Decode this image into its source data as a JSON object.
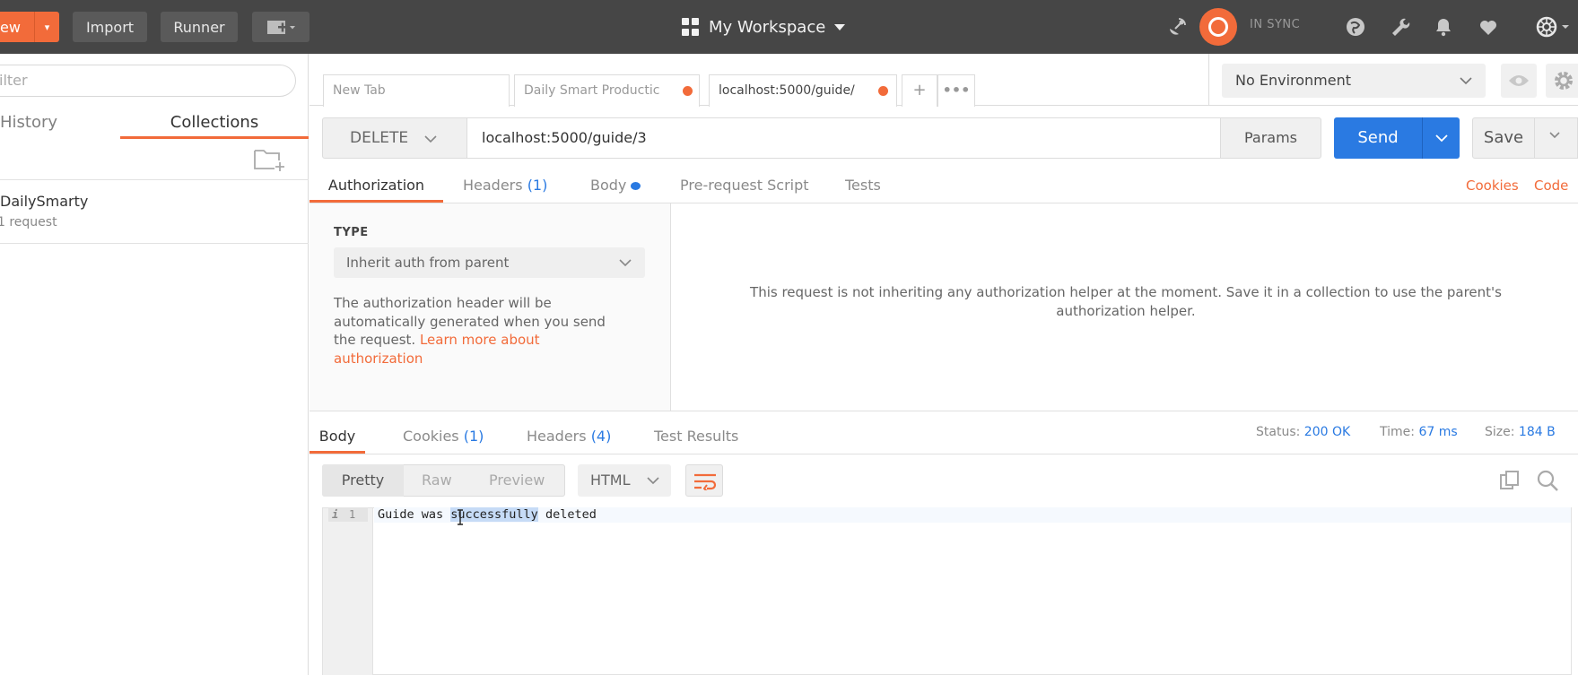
{
  "topbar": {
    "new_label": "ew",
    "import_label": "Import",
    "runner_label": "Runner",
    "workspace": "My Workspace",
    "sync_status": "IN SYNC",
    "accent": "#f26b3a"
  },
  "sidebar": {
    "filter_placeholder": "ilter",
    "tabs": {
      "history": "History",
      "collections": "Collections"
    },
    "collection": {
      "name": "DailySmarty",
      "count": "1 request"
    }
  },
  "request_tabs": [
    {
      "label": "New Tab"
    },
    {
      "label": "Daily Smart Productic"
    },
    {
      "label": "localhost:5000/guide/"
    }
  ],
  "environment": {
    "selected": "No Environment"
  },
  "request": {
    "method": "DELETE",
    "url": "localhost:5000/guide/3",
    "params_label": "Params",
    "send_label": "Send",
    "save_label": "Save",
    "tabs": {
      "authorization": "Authorization",
      "headers": "Headers",
      "headers_count": "(1)",
      "body": "Body",
      "prerequest": "Pre-request Script",
      "tests": "Tests"
    },
    "cookies_link": "Cookies",
    "code_link": "Code"
  },
  "auth": {
    "type_label": "TYPE",
    "type_value": "Inherit auth from parent",
    "description": "The authorization header will be automatically generated when you send the request.",
    "learn_more": "Learn more about authorization",
    "message": "This request is not inheriting any authorization helper at the moment. Save it in a collection to use the parent's authorization helper."
  },
  "response": {
    "tabs": {
      "body": "Body",
      "cookies": "Cookies",
      "cookies_count": "(1)",
      "headers": "Headers",
      "headers_count": "(4)",
      "test_results": "Test Results"
    },
    "status_label": "Status:",
    "status_value": "200 OK",
    "time_label": "Time:",
    "time_value": "67 ms",
    "size_label": "Size:",
    "size_value": "184 B",
    "formats": {
      "pretty": "Pretty",
      "raw": "Raw",
      "preview": "Preview"
    },
    "language": "HTML",
    "line_number": "1",
    "line_info": "i",
    "code_before": "Guide was ",
    "code_selected": "successfully",
    "code_after": " deleted"
  }
}
